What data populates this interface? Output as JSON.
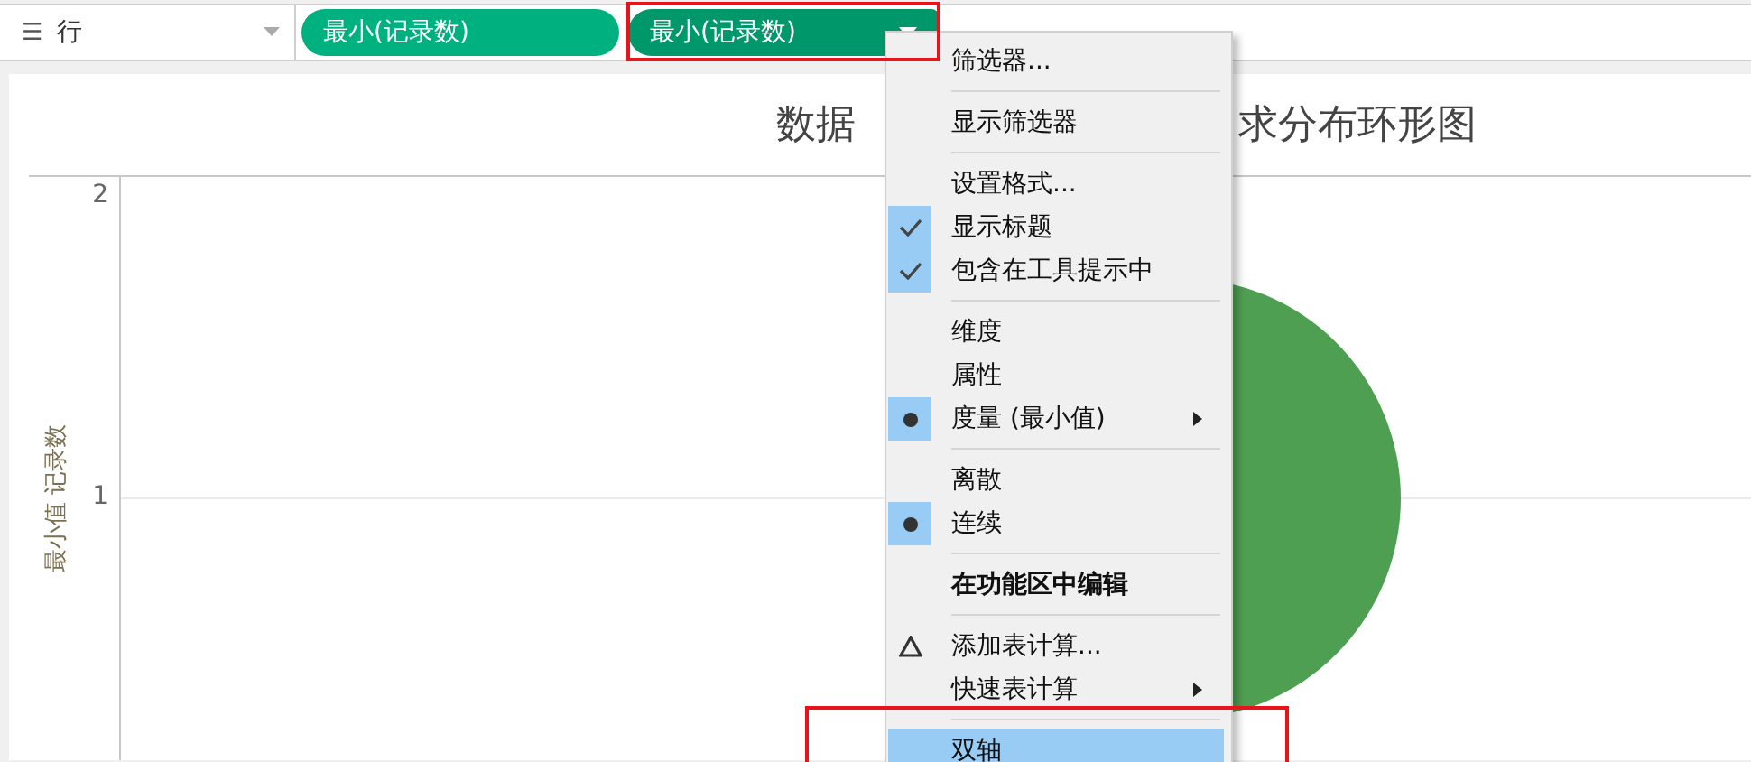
{
  "rows_shelf": {
    "icon_label": "☰",
    "label": "行",
    "pills": [
      {
        "label": "最小(记录数)",
        "selected": false
      },
      {
        "label": "最小(记录数)",
        "selected": true
      }
    ]
  },
  "chart": {
    "title_left": "数据",
    "title_right": "求分布环形图",
    "axis_label": "最小值 记录数",
    "yticks": [
      "2",
      "1"
    ]
  },
  "menu": {
    "items": [
      {
        "kind": "command",
        "label": "筛选器...",
        "highlighted": false
      },
      {
        "kind": "separator"
      },
      {
        "kind": "command",
        "label": "显示筛选器",
        "highlighted": false
      },
      {
        "kind": "separator"
      },
      {
        "kind": "command",
        "label": "设置格式...",
        "highlighted": false
      },
      {
        "kind": "check",
        "label": "显示标题",
        "checked": true,
        "highlighted": false
      },
      {
        "kind": "check",
        "label": "包含在工具提示中",
        "checked": true,
        "highlighted": false
      },
      {
        "kind": "separator"
      },
      {
        "kind": "radio",
        "label": "维度",
        "selected": false,
        "highlighted": false
      },
      {
        "kind": "radio",
        "label": "属性",
        "selected": false,
        "highlighted": false
      },
      {
        "kind": "radio",
        "label": "度量 (最小值)",
        "selected": true,
        "submenu": true,
        "highlighted": false
      },
      {
        "kind": "separator"
      },
      {
        "kind": "radio",
        "label": "离散",
        "selected": false,
        "highlighted": false
      },
      {
        "kind": "radio",
        "label": "连续",
        "selected": true,
        "highlighted": false
      },
      {
        "kind": "separator"
      },
      {
        "kind": "bold",
        "label": "在功能区中编辑",
        "highlighted": false
      },
      {
        "kind": "separator"
      },
      {
        "kind": "delta",
        "label": "添加表计算...",
        "highlighted": false
      },
      {
        "kind": "command",
        "label": "快速表计算",
        "submenu": true,
        "highlighted": false
      },
      {
        "kind": "separator"
      },
      {
        "kind": "command",
        "label": "双轴",
        "highlighted": true
      }
    ]
  }
}
